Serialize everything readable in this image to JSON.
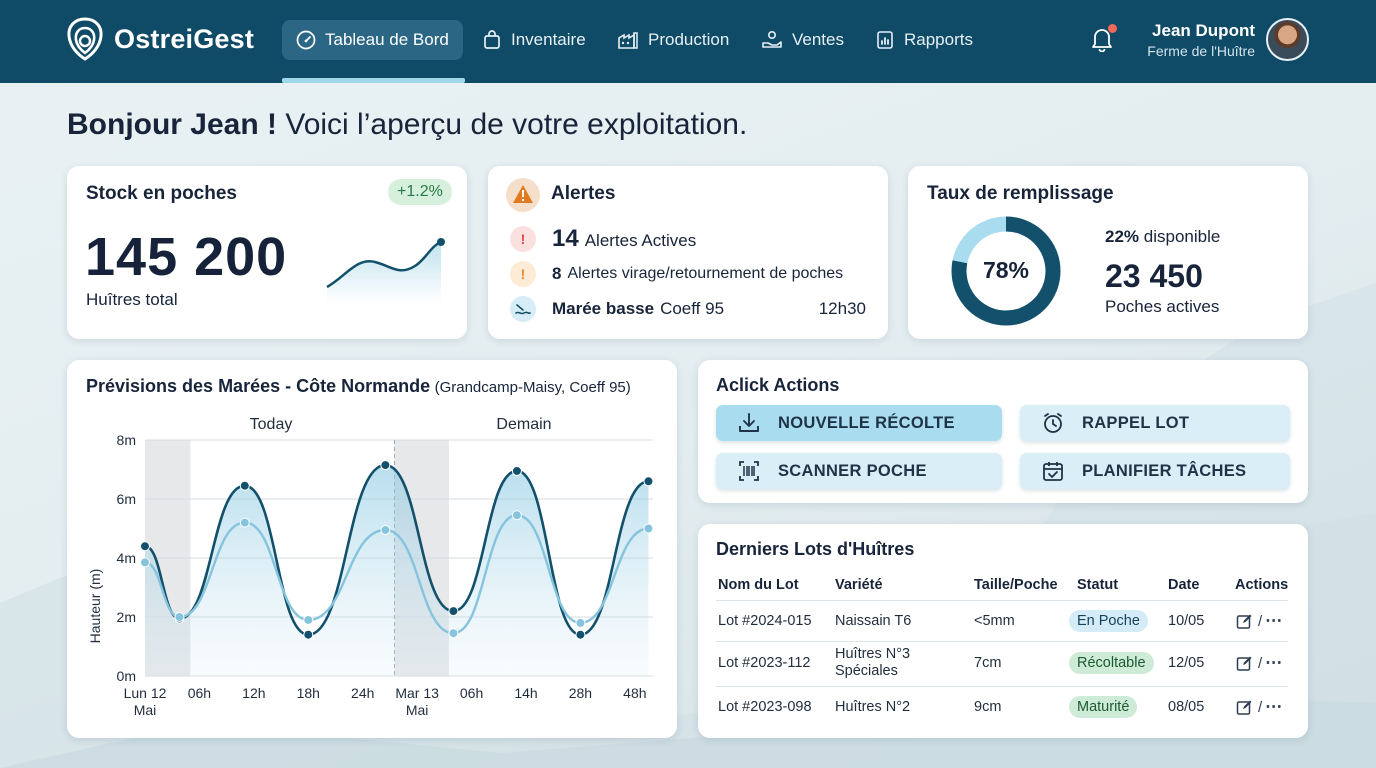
{
  "app": {
    "name": "OstreiGest"
  },
  "nav": {
    "items": [
      {
        "label": "Tableau de Bord",
        "icon": "gauge-icon",
        "active": true
      },
      {
        "label": "Inventaire",
        "icon": "bag-icon"
      },
      {
        "label": "Production",
        "icon": "factory-icon"
      },
      {
        "label": "Ventes",
        "icon": "hand-coin-icon"
      },
      {
        "label": "Rapports",
        "icon": "report-chart-icon"
      }
    ]
  },
  "user": {
    "name": "Jean Dupont",
    "farm": "Ferme de l'Huître",
    "has_notification": true
  },
  "greeting": {
    "bold": "Bonjour Jean !",
    "rest": " Voici l’aperçu de votre exploitation."
  },
  "stock": {
    "title": "Stock en poches",
    "badge": "+1.2%",
    "value": "145 200",
    "label": "Huîtres total"
  },
  "alerts": {
    "title": "Alertes",
    "active_count": "14",
    "active_label": "Alertes Actives",
    "turn_count": "8",
    "turn_label": "Alertes virage/retournement de poches",
    "tide_bold": "Marée basse",
    "tide_coeff": "Coeff 95",
    "tide_time": "12h30"
  },
  "fill": {
    "title": "Taux de remplissage",
    "percent_label": "78%",
    "percent": 78,
    "available_pct": "22%",
    "available_label": "disponible",
    "active_bags": "23 450",
    "active_bags_label": "Poches actives"
  },
  "tides": {
    "title": "Prévisions des Marées - Côte Normande",
    "subtitle": "(Grandcamp-Maisy, Coeff 95)",
    "day1": "Today",
    "day2": "Demain"
  },
  "chart_data": {
    "type": "area",
    "ylabel": "Hauteur (m)",
    "ylim": [
      0,
      8
    ],
    "yticks": [
      "0m",
      "2m",
      "4m",
      "6m",
      "8m"
    ],
    "xlim": [
      0,
      56
    ],
    "xticks": [
      {
        "x": 0,
        "label": "Lun 12",
        "label2": "Mai"
      },
      {
        "x": 6,
        "label": "06h"
      },
      {
        "x": 12,
        "label": "12h"
      },
      {
        "x": 18,
        "label": "18h"
      },
      {
        "x": 24,
        "label": "24h"
      },
      {
        "x": 30,
        "label": "Mar 13",
        "label2": "Mai"
      },
      {
        "x": 36,
        "label": "06h"
      },
      {
        "x": 42,
        "label": "14h"
      },
      {
        "x": 48,
        "label": "28h"
      },
      {
        "x": 54,
        "label": "48h"
      }
    ],
    "shaded_ranges": [
      [
        0,
        5
      ],
      [
        27.5,
        33.5
      ]
    ],
    "series": [
      {
        "color": "#13506b",
        "points": [
          [
            0,
            4.4
          ],
          [
            3.8,
            1.95
          ],
          [
            11,
            6.45
          ],
          [
            18,
            1.4
          ],
          [
            26.5,
            7.15
          ],
          [
            34,
            2.2
          ],
          [
            41,
            6.95
          ],
          [
            48,
            1.4
          ],
          [
            55.5,
            6.6
          ]
        ]
      },
      {
        "color": "#86c4dd",
        "points": [
          [
            0,
            3.85
          ],
          [
            3.8,
            2.0
          ],
          [
            11,
            5.2
          ],
          [
            18,
            1.9
          ],
          [
            26.5,
            4.95
          ],
          [
            34,
            1.45
          ],
          [
            41,
            5.45
          ],
          [
            48,
            1.8
          ],
          [
            55.5,
            5.0
          ]
        ]
      }
    ]
  },
  "quick": {
    "title": "Aclick Actions",
    "new_harvest": "NOUVELLE RÉCOLTE",
    "reminder": "RAPPEL LOT",
    "scan": "SCANNER POCHE",
    "plan": "PLANIFIER TÂCHES"
  },
  "lots": {
    "title": "Derniers Lots d'Huîtres",
    "columns": [
      "Nom du Lot",
      "Variété",
      "Taille/Poche",
      "Statut",
      "Date",
      "Actions"
    ],
    "rows": [
      {
        "name": "Lot #2024-015",
        "variety": "Naissain T6",
        "size": "<5mm",
        "status": "En Poche",
        "date": "10/05"
      },
      {
        "name": "Lot #2023-112",
        "variety": "Huîtres N°3 Spéciales",
        "size": "7cm",
        "status": "Récoltable",
        "date": "12/05"
      },
      {
        "name": "Lot #2023-098",
        "variety": "Huîtres N°2",
        "size": "9cm",
        "status": "Maturité",
        "date": "08/05"
      }
    ],
    "actions_sep": "/",
    "actions_more": "⋯"
  },
  "colors": {
    "primary": "#0f4a66",
    "accent": "#9fd8ea",
    "green": "#2a7a45",
    "alert_red": "#e0474c",
    "alert_orange": "#e8893a"
  }
}
